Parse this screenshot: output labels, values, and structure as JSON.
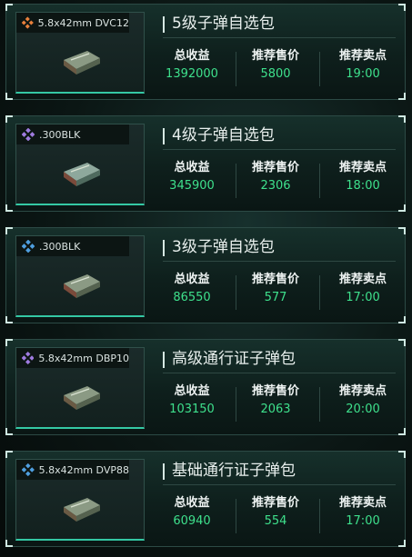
{
  "labels": {
    "total": "总收益",
    "price": "推荐售价",
    "time": "推荐卖点"
  },
  "cards": [
    {
      "caliber": "5.8x42mm DVC12",
      "gem_icon": "orange-gem-icon",
      "gem_color": "#e8803c",
      "title": "5级子弹自选包",
      "total": "1392000",
      "price": "5800",
      "time": "19:00"
    },
    {
      "caliber": ".300BLK",
      "gem_icon": "purple-gem-icon",
      "gem_color": "#9f7be0",
      "title": "4级子弹自选包",
      "total": "345900",
      "price": "2306",
      "time": "18:00"
    },
    {
      "caliber": ".300BLK",
      "gem_icon": "blue-gem-icon",
      "gem_color": "#4f9fe0",
      "title": "3级子弹自选包",
      "total": "86550",
      "price": "577",
      "time": "17:00"
    },
    {
      "caliber": "5.8x42mm DBP10",
      "gem_icon": "purple-gem-icon",
      "gem_color": "#9f7be0",
      "title": "高级通行证子弹包",
      "total": "103150",
      "price": "2063",
      "time": "20:00"
    },
    {
      "caliber": "5.8x42mm DVP88",
      "gem_icon": "blue-gem-icon",
      "gem_color": "#4f9fe0",
      "title": "基础通行证子弹包",
      "total": "60940",
      "price": "554",
      "time": "17:00"
    }
  ]
}
